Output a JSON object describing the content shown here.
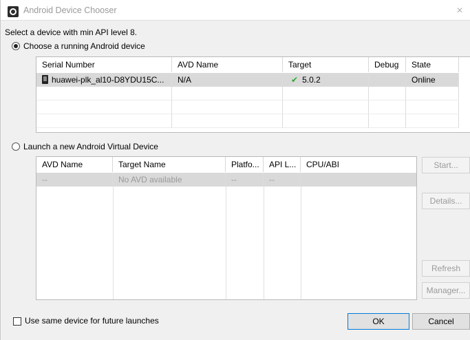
{
  "window": {
    "title": "Android Device Chooser",
    "icon": "android-chooser-icon",
    "close_symbol": "×"
  },
  "prompt": "Select a device with min API level 8.",
  "running": {
    "radio_label": "Choose a running Android device",
    "selected": true,
    "columns": [
      "Serial Number",
      "AVD Name",
      "Target",
      "Debug",
      "State"
    ],
    "rows": [
      {
        "serial": "huawei-plk_al10-D8YDU15C...",
        "avd_name": "N/A",
        "target": "5.0.2",
        "debug": "",
        "state": "Online",
        "device_icon": "phone-icon",
        "target_icon": "checkmark-icon"
      }
    ]
  },
  "virtual": {
    "radio_label": "Launch a new Android Virtual Device",
    "selected": false,
    "columns": [
      "AVD Name",
      "Target Name",
      "Platfo...",
      "API L...",
      "CPU/ABI"
    ],
    "rows": [
      {
        "avd_name": "--",
        "target_name": "No AVD available",
        "platform": "--",
        "api": "--",
        "cpu": ""
      }
    ],
    "buttons": {
      "start": "Start...",
      "details": "Details...",
      "refresh": "Refresh",
      "manager": "Manager..."
    }
  },
  "footer": {
    "checkbox_label": "Use same device for future launches",
    "checked": false,
    "ok_label": "OK",
    "cancel_label": "Cancel"
  },
  "colors": {
    "accent": "#0078d7",
    "check": "#2fa82f",
    "selection": "#d9d9d9"
  }
}
